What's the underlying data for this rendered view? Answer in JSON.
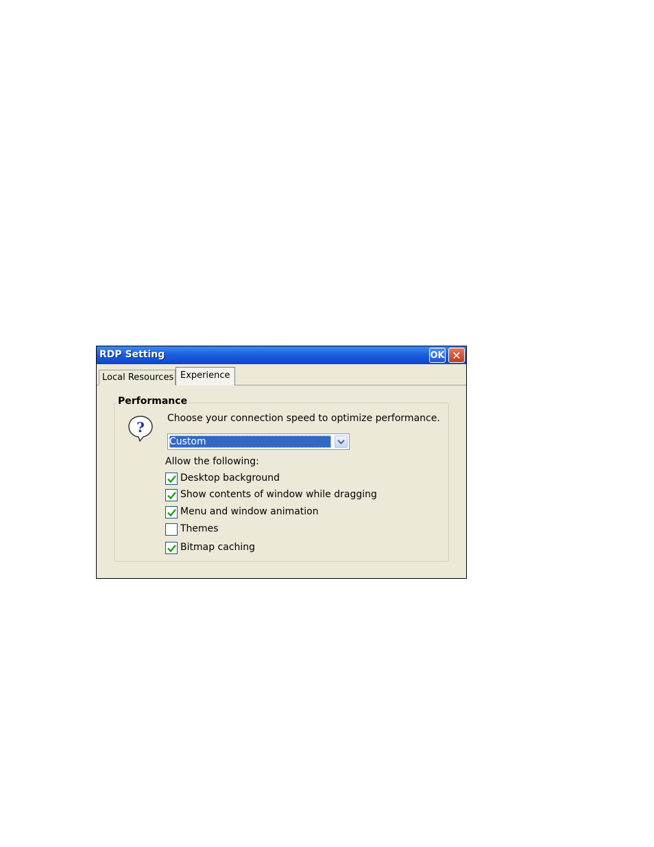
{
  "window": {
    "title": "RDP Setting",
    "ok_label": "OK",
    "close_label": "✕"
  },
  "tabs": [
    {
      "label": "Local Resources",
      "active": false
    },
    {
      "label": "Experience",
      "active": true
    }
  ],
  "performance": {
    "group_label": "Performance",
    "prompt": "Choose your connection speed to optimize performance.",
    "speed_select": {
      "value": "Custom"
    },
    "allow_label": "Allow the following:",
    "options": [
      {
        "label": "Desktop background",
        "checked": true
      },
      {
        "label": "Show contents of window while dragging",
        "checked": true
      },
      {
        "label": "Menu and window animation",
        "checked": true
      },
      {
        "label": "Themes",
        "checked": false
      },
      {
        "label": "Bitmap caching",
        "checked": true
      }
    ]
  },
  "colors": {
    "titlebar": "#0a47c8",
    "selection": "#316ac5",
    "dialog_bg": "#ece9d8",
    "check": "#21a121"
  }
}
